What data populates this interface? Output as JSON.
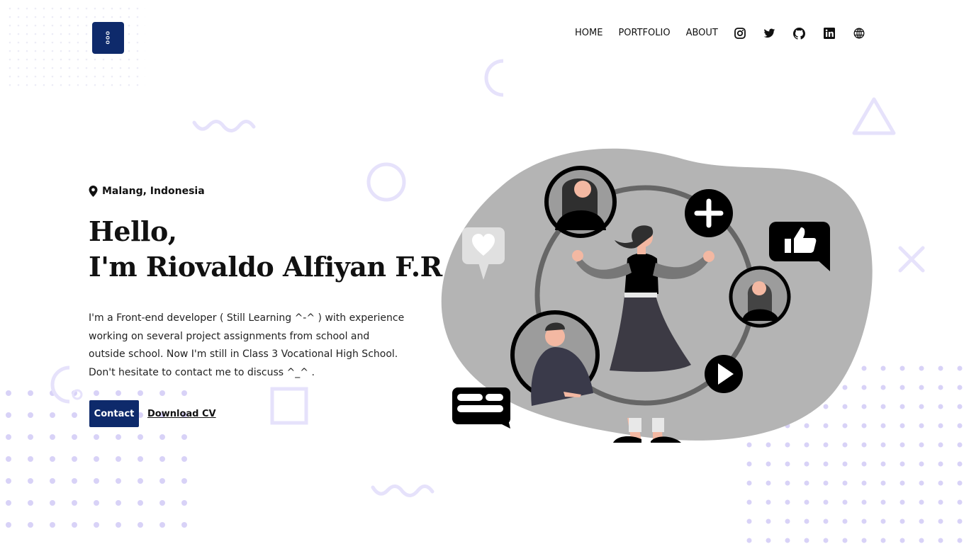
{
  "brand": {
    "logo_text": "ooo",
    "color": "#0e2a6b"
  },
  "nav": {
    "items": [
      {
        "label": "HOME"
      },
      {
        "label": "PORTFOLIO"
      },
      {
        "label": "ABOUT"
      }
    ],
    "social_icons": [
      "instagram-icon",
      "twitter-icon",
      "github-icon",
      "linkedin-icon",
      "globe-icon"
    ]
  },
  "hero": {
    "location": "Malang, Indonesia",
    "greeting": "Hello,",
    "name_line": "I'm Riovaldo Alfiyan F.R",
    "description": "I'm a Front-end developer ( Still Learning ^-^ ) with experience working on several project assignments from school and outside school. Now I'm still in Class 3 Vocational High School. Don't hesitate to contact me to discuss ^_^ .",
    "contact_label": "Contact",
    "cv_label": "Download CV"
  },
  "colors": {
    "accent": "#0e2a6b",
    "decor": "#e6e2fb",
    "dots": "#d8d2f7",
    "blob": "#b4b4b4"
  }
}
